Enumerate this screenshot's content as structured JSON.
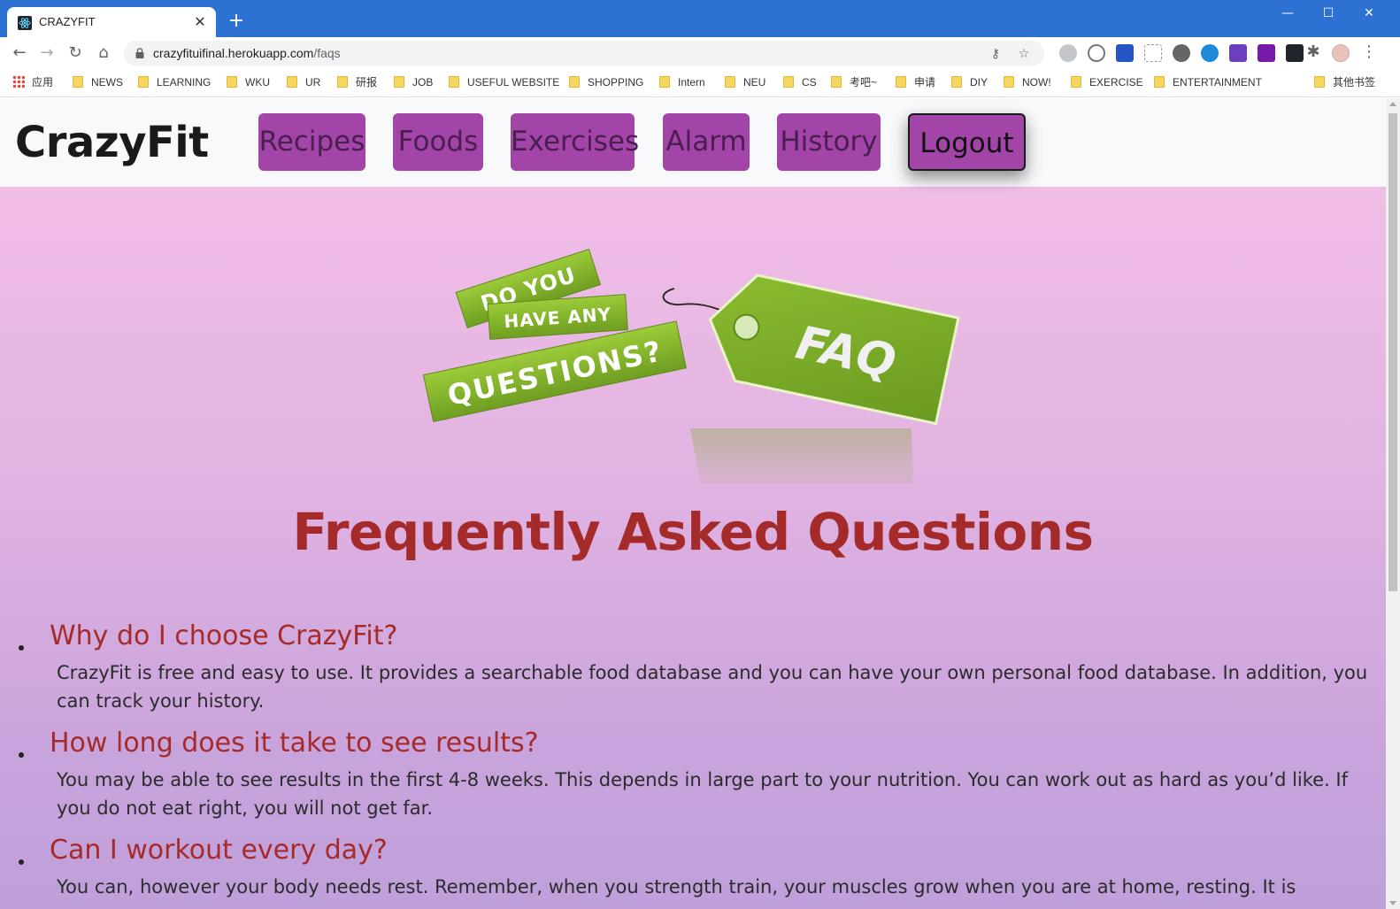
{
  "browser": {
    "tab_title": "CRAZYFIT",
    "tab_close": "✕",
    "new_tab": "+",
    "url_host": "crazyfituifinal.herokuapp.com",
    "url_path": "/faqs",
    "window_minimize": "—",
    "window_maximize": "☐",
    "window_close": "✕",
    "icons": {
      "back": "←",
      "forward": "→",
      "reload": "↻",
      "home": "⌂",
      "key": "⚷",
      "star": "☆",
      "menu": "⋮",
      "puzzle": "✱"
    }
  },
  "bookmarks": [
    {
      "label": "应用",
      "type": "apps"
    },
    {
      "label": "NEWS",
      "type": "folder"
    },
    {
      "label": "LEARNING",
      "type": "folder"
    },
    {
      "label": "WKU",
      "type": "folder"
    },
    {
      "label": "UR",
      "type": "folder"
    },
    {
      "label": "研报",
      "type": "folder"
    },
    {
      "label": "JOB",
      "type": "folder"
    },
    {
      "label": "USEFUL WEBSITE",
      "type": "folder"
    },
    {
      "label": "SHOPPING",
      "type": "folder"
    },
    {
      "label": "Intern",
      "type": "folder"
    },
    {
      "label": "NEU",
      "type": "folder"
    },
    {
      "label": "CS",
      "type": "folder"
    },
    {
      "label": "考吧~",
      "type": "folder"
    },
    {
      "label": "申请",
      "type": "folder"
    },
    {
      "label": "DIY",
      "type": "folder"
    },
    {
      "label": "NOW!",
      "type": "folder"
    },
    {
      "label": "EXERCISE",
      "type": "folder"
    },
    {
      "label": "ENTERTAINMENT",
      "type": "folder"
    },
    {
      "label": "其他书签",
      "type": "folder"
    }
  ],
  "site": {
    "brand": "CrazyFit",
    "nav": [
      "Recipes",
      "Foods",
      "Exercises",
      "Alarm",
      "History"
    ],
    "logout": "Logout",
    "art": {
      "line1": "DO YOU",
      "line2": "HAVE ANY",
      "line3": "QUESTIONS?",
      "tag": "FAQ"
    },
    "title": "Frequently Asked Questions",
    "faqs": [
      {
        "question": "Why do I choose CrazyFit?",
        "answer": "CrazyFit is free and easy to use. It provides a searchable food database and you can have your own personal food database. In addition, you can track your history."
      },
      {
        "question": "How long does it take to see results?",
        "answer": "You may be able to see results in the first 4-8 weeks. This depends in large part to your nutrition. You can work out as hard as you’d like. If you do not eat right, you will not get far."
      },
      {
        "question": "Can I workout every day?",
        "answer": "You can, however your body needs rest. Remember, when you strength train, your muscles grow when you are at home, resting. It is"
      }
    ]
  },
  "colors": {
    "chrome_blue": "#2d72d3",
    "nav_button": "#a244a8",
    "heading_red": "#a52a2a",
    "tag_green": "#7cab2a"
  }
}
